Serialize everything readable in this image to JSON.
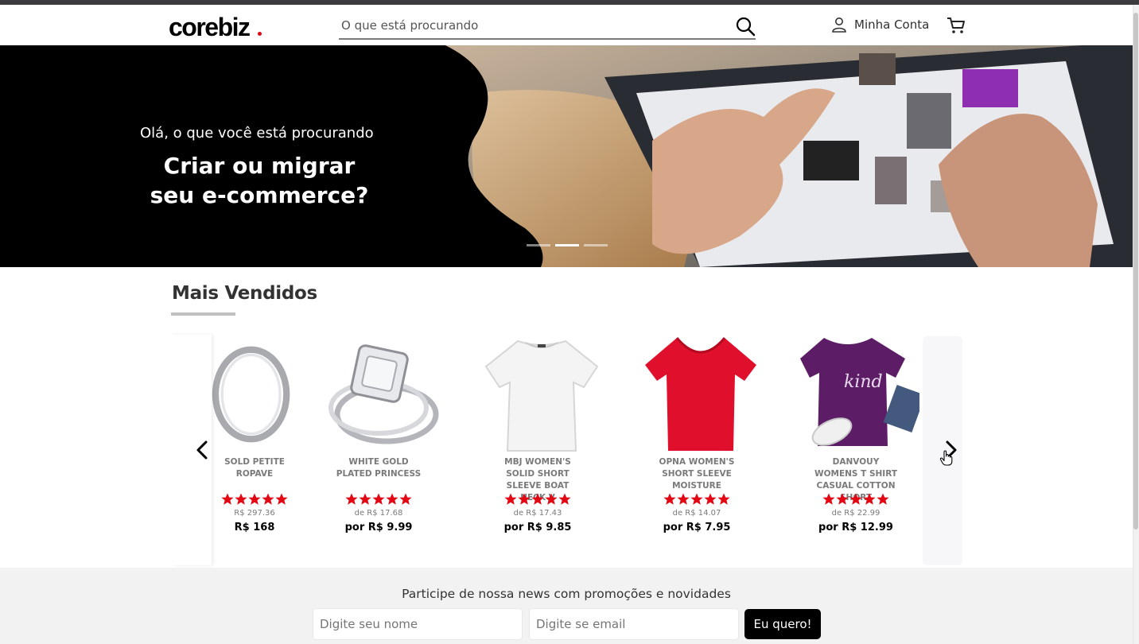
{
  "header": {
    "logo_text": "corebiz",
    "search_placeholder": "O que está procurando",
    "account_label": "Minha Conta"
  },
  "hero": {
    "subtitle": "Olá, o que você está procurando",
    "title": "Criar ou migrar seu e-commerce?",
    "slides_count": 3,
    "active_slide": 2
  },
  "best_sellers": {
    "title": "Mais Vendidos",
    "products": [
      {
        "name": "SOLD PETITE ROPAVE",
        "rating": 5,
        "old_price": "R$ 297.36",
        "price": "R$ 168"
      },
      {
        "name": "WHITE GOLD PLATED PRINCESS",
        "rating": 5,
        "old_price": "de R$ 17.68",
        "price": "por R$ 9.99"
      },
      {
        "name": "MBJ WOMEN'S SOLID SHORT SLEEVE BOAT NECK V",
        "rating": 5,
        "old_price": "de R$ 17.43",
        "price": "por R$ 9.85"
      },
      {
        "name": "OPNA WOMEN'S SHORT SLEEVE MOISTURE",
        "rating": 5,
        "old_price": "de R$ 14.07",
        "price": "por R$ 7.95"
      },
      {
        "name": "DANVOUY WOMENS T SHIRT CASUAL COTTON SHORT",
        "rating": 5,
        "old_price": "de R$ 22.99",
        "price": "por R$ 12.99"
      }
    ]
  },
  "newsletter": {
    "title": "Participe de nossa news com promoções e novidades",
    "name_placeholder": "Digite seu nome",
    "email_placeholder": "Digite se email",
    "submit_label": "Eu quero!"
  },
  "colors": {
    "star": "#e30613",
    "accent_dark": "#000000",
    "background_footer": "#f2f2f2"
  }
}
